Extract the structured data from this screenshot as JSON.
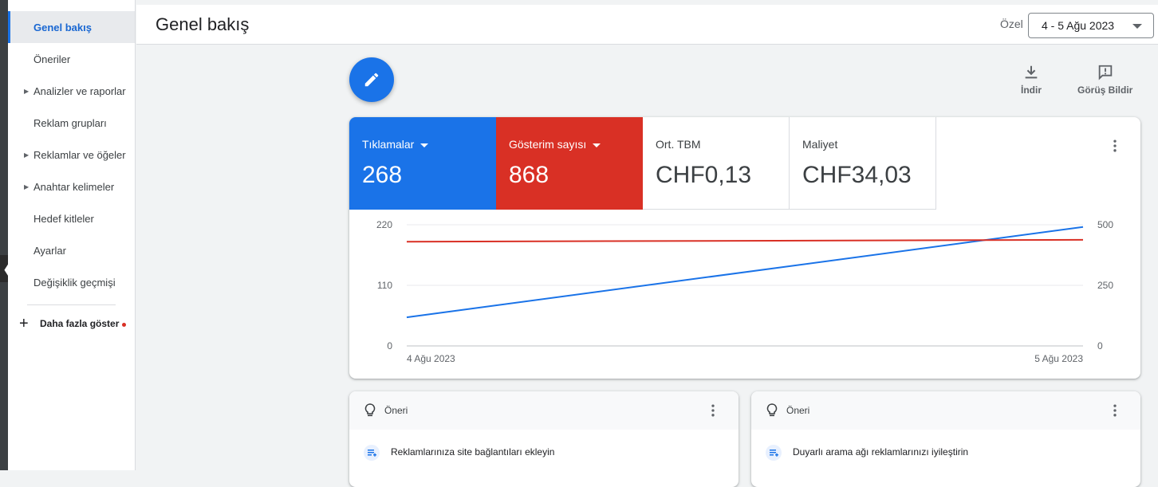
{
  "sidebar": {
    "items": [
      {
        "label": "Genel bakış",
        "active": true,
        "expandable": false
      },
      {
        "label": "Öneriler",
        "active": false,
        "expandable": false
      },
      {
        "label": "Analizler ve raporlar",
        "active": false,
        "expandable": true
      },
      {
        "label": "Reklam grupları",
        "active": false,
        "expandable": false
      },
      {
        "label": "Reklamlar ve öğeler",
        "active": false,
        "expandable": true
      },
      {
        "label": "Anahtar kelimeler",
        "active": false,
        "expandable": true
      },
      {
        "label": "Hedef kitleler",
        "active": false,
        "expandable": false
      },
      {
        "label": "Ayarlar",
        "active": false,
        "expandable": false
      },
      {
        "label": "Değişiklik geçmişi",
        "active": false,
        "expandable": false
      }
    ],
    "more_label": "Daha fazla göster"
  },
  "header": {
    "title": "Genel bakış",
    "date_label": "Özel",
    "date_range": "4 - 5 Ağu 2023"
  },
  "toolbar": {
    "download_label": "İndir",
    "feedback_label": "Görüş Bildir"
  },
  "metrics": [
    {
      "label": "Tıklamalar",
      "value": "268",
      "color": "#1a73e8",
      "selected": true
    },
    {
      "label": "Gösterim sayısı",
      "value": "868",
      "color": "#d93025",
      "selected": true
    },
    {
      "label": "Ort. TBM",
      "value": "CHF0,13",
      "selected": false
    },
    {
      "label": "Maliyet",
      "value": "CHF34,03",
      "selected": false
    }
  ],
  "chart_data": {
    "type": "line",
    "x": [
      "4 Ağu 2023",
      "5 Ağu 2023"
    ],
    "series": [
      {
        "name": "Tıklamalar",
        "axis": "left",
        "color": "#1a73e8",
        "values": [
          52,
          216
        ]
      },
      {
        "name": "Gösterim sayısı",
        "axis": "right",
        "color": "#d93025",
        "values": [
          430,
          438
        ]
      }
    ],
    "y_left": {
      "ticks": [
        "0",
        "110",
        "220"
      ],
      "range": [
        0,
        220
      ]
    },
    "y_right": {
      "ticks": [
        "0",
        "250",
        "500"
      ],
      "range": [
        0,
        500
      ]
    },
    "grid": true
  },
  "recommendations": [
    {
      "header": "Öneri",
      "text": "Reklamlarınıza site bağlantıları ekleyin"
    },
    {
      "header": "Öneri",
      "text": "Duyarlı arama ağı reklamlarınızı iyileştirin"
    }
  ]
}
